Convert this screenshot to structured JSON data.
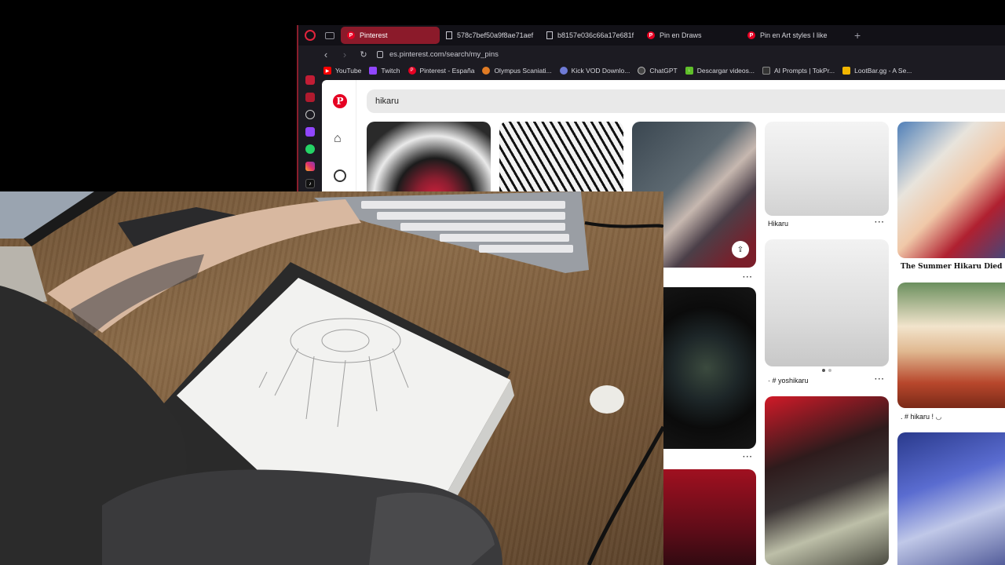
{
  "browser": {
    "tabs": [
      {
        "label": "Pinterest",
        "icon": "pinterest-icon",
        "active": true
      },
      {
        "label": "578c7bef50a9f8ae71aef",
        "icon": "document-icon",
        "active": false
      },
      {
        "label": "b8157e036c66a17e681f",
        "icon": "document-icon",
        "active": false
      },
      {
        "label": "Pin en Draws",
        "icon": "pinterest-icon",
        "active": false
      },
      {
        "label": "Pin en Art styles I like",
        "icon": "pinterest-icon",
        "active": false
      }
    ],
    "new_tab": "+",
    "url": "es.pinterest.com/search/my_pins",
    "bookmarks": [
      {
        "label": "YouTube",
        "color": "#ff0000"
      },
      {
        "label": "Twitch",
        "color": "#9146ff"
      },
      {
        "label": "Pinterest - España",
        "color": "#e60023"
      },
      {
        "label": "Olympus Scaniati...",
        "color": "#e07b24"
      },
      {
        "label": "Kick VOD Downlo...",
        "color": "#6f7bd6"
      },
      {
        "label": "ChatGPT",
        "color": "#444444"
      },
      {
        "label": "Descargar videos...",
        "color": "#5fbf2a"
      },
      {
        "label": "AI Prompts | TokPr...",
        "color": "#333333"
      },
      {
        "label": "LootBar.gg - A Se...",
        "color": "#f2b600"
      }
    ]
  },
  "pinterest": {
    "logo": "P",
    "search_value": "hikaru",
    "captions": {
      "hikaru": "Hikaru",
      "summer": "The Summer Hikaru Died",
      "yoshikaru": "· # yoshikaru",
      "hikaru_tag": ". # hikaru ! ◡"
    },
    "more": "···"
  },
  "colors": {
    "accent": "#e60023",
    "opera_red": "#8b1a2a"
  }
}
